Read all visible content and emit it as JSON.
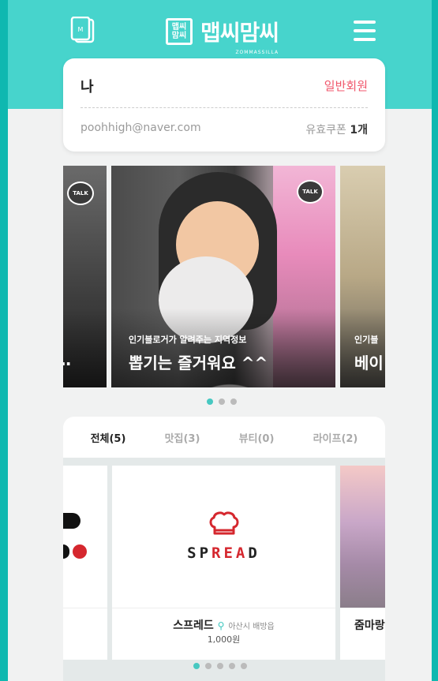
{
  "header": {
    "logo_box_text": "맵씨 맘씨",
    "logo_text": "맵씨맘씨",
    "logo_subtext": "ZOMMASSILLA",
    "icons": {
      "left": "card-stack-icon",
      "menu": "hamburger-menu-icon"
    },
    "colors": {
      "topbar": "#47d4cc",
      "frame": "#0fb8b0"
    }
  },
  "profile": {
    "name": "나",
    "grade": "일반회원",
    "email": "poohhigh@naver.com",
    "coupon_label": "유효쿠폰",
    "coupon_count": "1개",
    "grade_color": "#f0566b"
  },
  "carousel": {
    "badge": "TALK",
    "slides": [
      {
        "subtitle": "",
        "title": "…"
      },
      {
        "subtitle": "인기블로거가 알려주는 지역정보",
        "title": "뽑기는 즐거워요 ^^"
      },
      {
        "subtitle": "인기블",
        "title": "베이"
      }
    ],
    "dots": 3,
    "active_dot": 0
  },
  "categories": {
    "tabs": [
      {
        "label": "전체(5)",
        "active": true
      },
      {
        "label": "맛집(3)",
        "active": false
      },
      {
        "label": "뷰티(0)",
        "active": false
      },
      {
        "label": "라이프(2)",
        "active": false
      }
    ]
  },
  "products": {
    "main": {
      "brand_prefix": "SP",
      "brand_accent": "REA",
      "brand_suffix": "D",
      "name": "스프레드",
      "location": "아산시 배방읍",
      "price": "1,000원"
    },
    "right": {
      "name": "줌마랑"
    },
    "dots": 5,
    "active_dot": 0
  }
}
